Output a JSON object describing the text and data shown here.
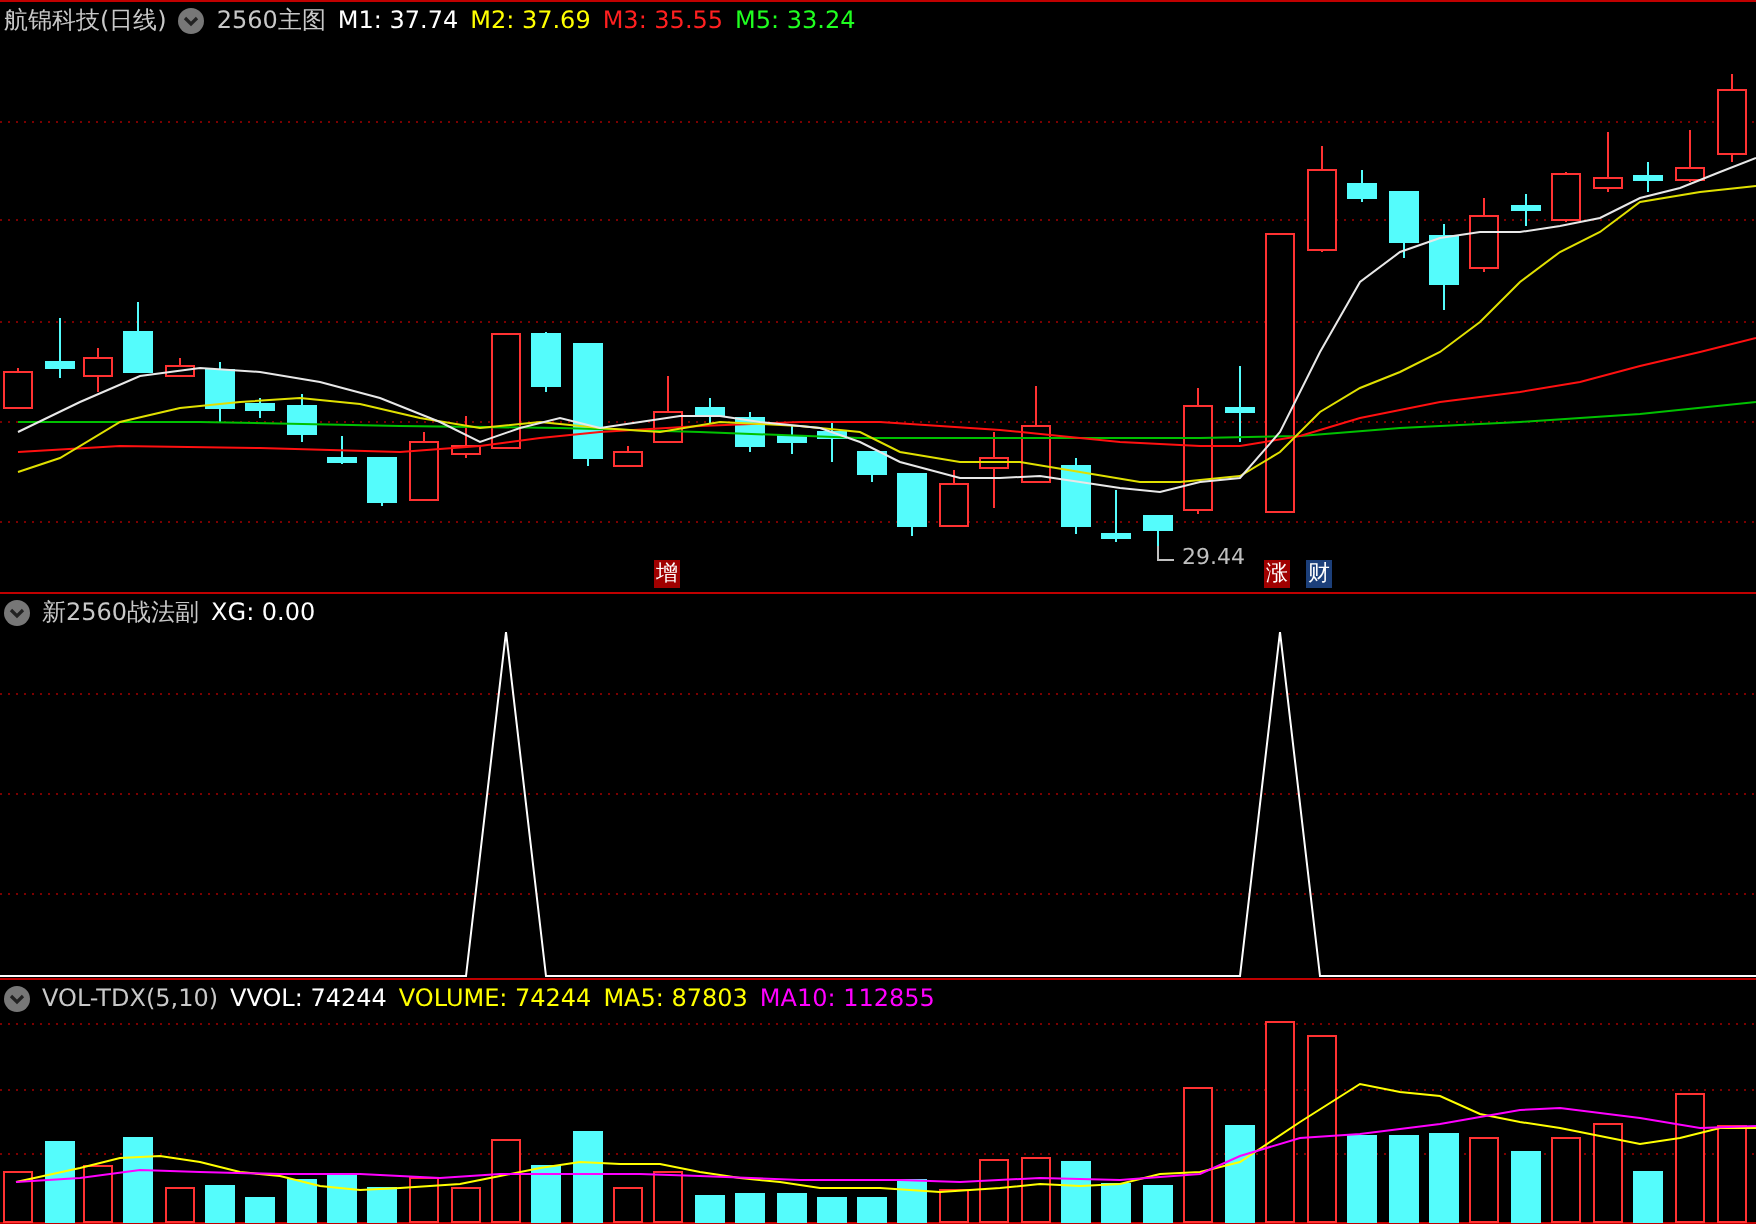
{
  "main_panel": {
    "title": "航锦科技(日线)",
    "indicator": "2560主图",
    "legend": [
      {
        "text": "M1: 37.74",
        "color": "#ffffff"
      },
      {
        "text": "M2: 37.69",
        "color": "#ffff00"
      },
      {
        "text": "M3: 35.55",
        "color": "#ff2020"
      },
      {
        "text": "M5: 33.24",
        "color": "#20ff20"
      }
    ],
    "low_label": "29.44",
    "signals": [
      {
        "text": "增",
        "color": "#a00000"
      },
      {
        "text": "涨",
        "color": "#a00000"
      },
      {
        "text": "财",
        "color": "#1c3f7a"
      }
    ]
  },
  "sub_panel": {
    "title": "新2560战法副",
    "legend": [
      {
        "text": "XG: 0.00",
        "color": "#ffffff"
      }
    ]
  },
  "volume_panel": {
    "title": "VOL-TDX(5,10)",
    "legend": [
      {
        "text": "VVOL: 74244",
        "color": "#ffffff"
      },
      {
        "text": "VOLUME: 74244",
        "color": "#ffff00"
      },
      {
        "text": "MA5: 87803",
        "color": "#ffff00"
      },
      {
        "text": "MA10: 112855",
        "color": "#ff00ff"
      }
    ]
  }
}
